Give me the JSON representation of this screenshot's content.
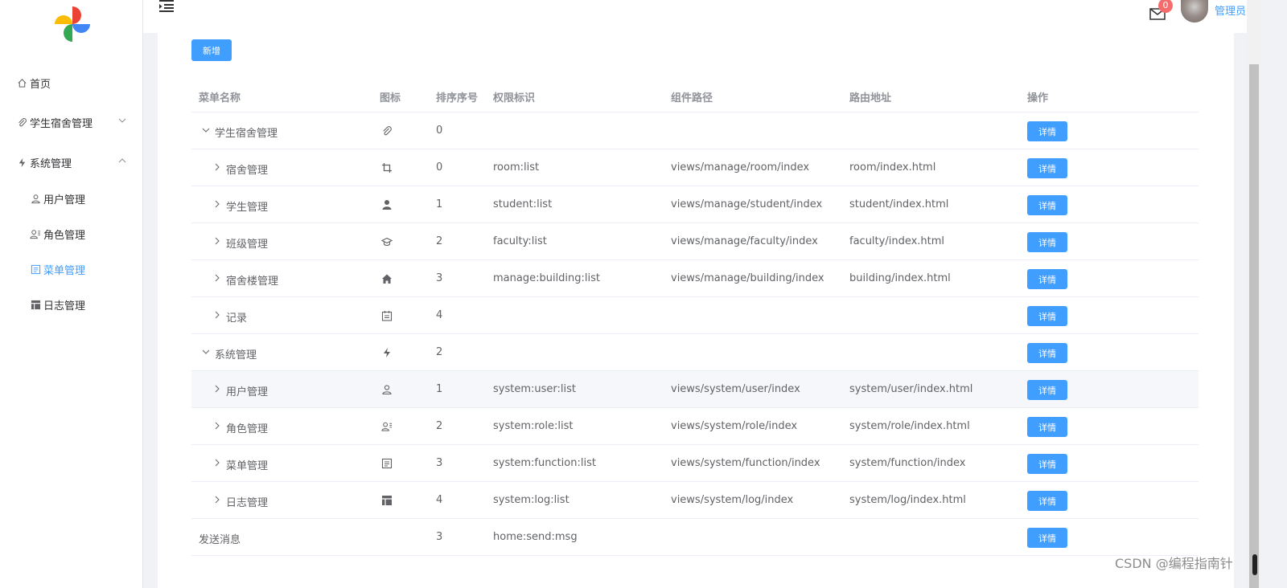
{
  "sidebar": {
    "items": [
      {
        "label": "首页",
        "icon": "home-icon"
      },
      {
        "label": "学生宿舍管理",
        "icon": "paperclip-icon",
        "expanded": false
      },
      {
        "label": "系统管理",
        "icon": "lightning-icon",
        "expanded": true
      },
      {
        "label": "用户管理",
        "icon": "user-icon"
      },
      {
        "label": "角色管理",
        "icon": "user-role-icon"
      },
      {
        "label": "菜单管理",
        "icon": "document-list-icon",
        "active": true
      },
      {
        "label": "日志管理",
        "icon": "grid-table-icon"
      }
    ]
  },
  "header": {
    "badge_count": "0",
    "user_name": "管理员"
  },
  "toolbar": {
    "add_label": "新增"
  },
  "table": {
    "headers": {
      "name": "菜单名称",
      "icon": "图标",
      "sort": "排序序号",
      "perm": "权限标识",
      "component": "组件路径",
      "route": "路由地址",
      "action": "操作"
    },
    "action_label": "详情",
    "rows": [
      {
        "name": "学生宿舍管理",
        "level": 0,
        "expander": "down",
        "icon": "paperclip-icon",
        "sort": "0",
        "perm": "",
        "component": "",
        "route": ""
      },
      {
        "name": "宿舍管理",
        "level": 1,
        "expander": "right",
        "icon": "crop-icon",
        "sort": "0",
        "perm": "room:list",
        "component": "views/manage/room/index",
        "route": "room/index.html"
      },
      {
        "name": "学生管理",
        "level": 1,
        "expander": "right",
        "icon": "user-solid-icon",
        "sort": "1",
        "perm": "student:list",
        "component": "views/manage/student/index",
        "route": "student/index.html"
      },
      {
        "name": "班级管理",
        "level": 1,
        "expander": "right",
        "icon": "graduation-cap-icon",
        "sort": "2",
        "perm": "faculty:list",
        "component": "views/manage/faculty/index",
        "route": "faculty/index.html"
      },
      {
        "name": "宿舍楼管理",
        "level": 1,
        "expander": "right",
        "icon": "house-icon",
        "sort": "3",
        "perm": "manage:building:list",
        "component": "views/manage/building/index",
        "route": "building/index.html"
      },
      {
        "name": "记录",
        "level": 1,
        "expander": "right",
        "icon": "calendar-icon",
        "sort": "4",
        "perm": "",
        "component": "",
        "route": ""
      },
      {
        "name": "系统管理",
        "level": 0,
        "expander": "down",
        "icon": "lightning-icon",
        "sort": "2",
        "perm": "",
        "component": "",
        "route": ""
      },
      {
        "name": "用户管理",
        "level": 1,
        "expander": "right",
        "icon": "user-icon",
        "sort": "1",
        "perm": "system:user:list",
        "component": "views/system/user/index",
        "route": "system/user/index.html",
        "hover": true
      },
      {
        "name": "角色管理",
        "level": 1,
        "expander": "right",
        "icon": "user-role-icon",
        "sort": "2",
        "perm": "system:role:list",
        "component": "views/system/role/index",
        "route": "system/role/index.html"
      },
      {
        "name": "菜单管理",
        "level": 1,
        "expander": "right",
        "icon": "document-list-icon",
        "sort": "3",
        "perm": "system:function:list",
        "component": "views/system/function/index",
        "route": "system/function/index"
      },
      {
        "name": "日志管理",
        "level": 1,
        "expander": "right",
        "icon": "grid-table-icon",
        "sort": "4",
        "perm": "system:log:list",
        "component": "views/system/log/index",
        "route": "system/log/index.html"
      },
      {
        "name": "发送消息",
        "level": 0,
        "expander": "none",
        "icon": "",
        "sort": "3",
        "perm": "home:send:msg",
        "component": "",
        "route": ""
      }
    ]
  },
  "watermark": "CSDN @编程指南针",
  "colors": {
    "primary": "#409eff",
    "badge": "#f56c6c",
    "header_text": "#909399",
    "body_text": "#606266"
  }
}
